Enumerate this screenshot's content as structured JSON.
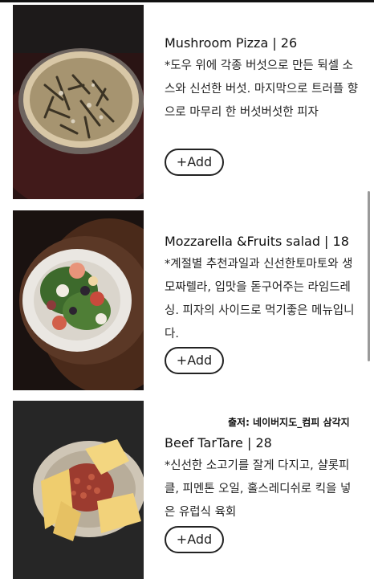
{
  "menu": {
    "items": [
      {
        "name": "Mushroom Pizza | 26",
        "description": "*도우 위에 각종 버섯으로 만든 뒥셀 소스와 신선한 버섯. 마지막으로 트러플 향으로 마무리 한 버섯버섯한 피자",
        "add_label": "+Add",
        "image_icon": "mushroom-pizza-photo"
      },
      {
        "name": "Mozzarella &Fruits salad | 18",
        "description": "*계절별 추천과일과 신선한토마토와 생모짜렐라, 입맛을 돋구어주는 라임드레싱. 피자의 사이드로 먹기좋은 메뉴입니다.",
        "add_label": "+Add",
        "image_icon": "salad-photo"
      },
      {
        "name": "Beef TarTare | 28",
        "description": "*신선한 소고기를 잘게 다지고, 샬롯피클, 피멘톤 오일, 홀스레디쉬로 킥을 넣은 유럽식 육회",
        "add_label": "+Add",
        "image_icon": "beef-tartare-photo"
      }
    ]
  },
  "source_caption": "출저: 네이버지도_컴피 삼각지"
}
